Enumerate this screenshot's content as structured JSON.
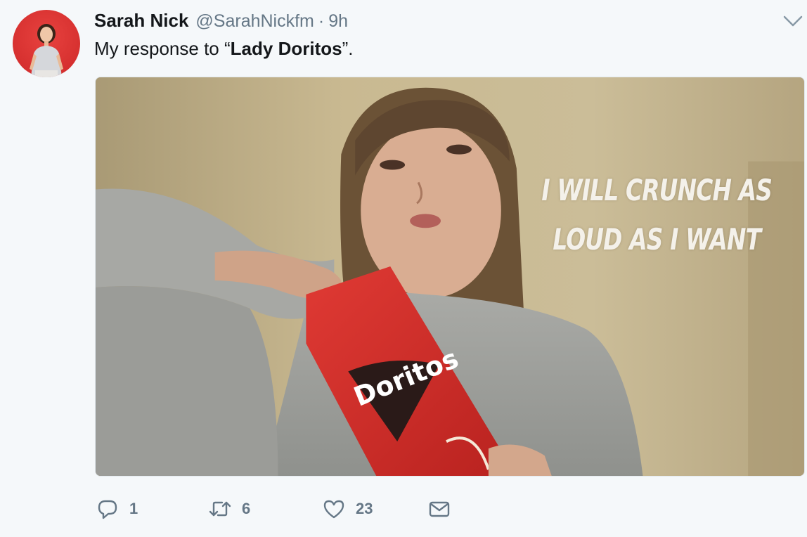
{
  "tweet": {
    "author": {
      "display_name": "Sarah Nick",
      "handle": "@SarahNickfm"
    },
    "separator": "·",
    "time": "9h",
    "text_prefix": "My response to ",
    "text_open_quote": "“",
    "text_bold": "Lady Doritos",
    "text_suffix": "”.",
    "media": {
      "overlay_line1": "I WILL CRUNCH AS",
      "overlay_line2": "LOUD AS I WANT",
      "bag_brand": "Doritos"
    },
    "actions": {
      "reply_count": "1",
      "retweet_count": "6",
      "like_count": "23"
    }
  },
  "icons": {
    "menu": "chevron-down-icon",
    "reply": "reply-icon",
    "retweet": "retweet-icon",
    "like": "heart-icon",
    "message": "envelope-icon"
  },
  "colors": {
    "background": "#f5f8fa",
    "text": "#14171a",
    "secondary": "#657786",
    "avatar_bg": "#d6302f",
    "bag_red": "#d92f2a"
  }
}
